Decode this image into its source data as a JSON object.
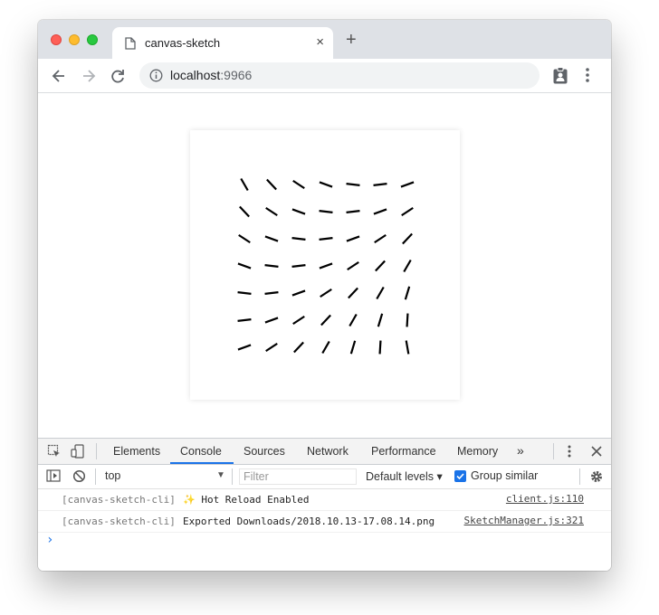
{
  "browser": {
    "tab_title": "canvas-sketch",
    "close_tab_glyph": "×",
    "new_tab_glyph": "+",
    "url_host": "localhost",
    "url_port": ":9966"
  },
  "sketch": {
    "grid_rows": 7,
    "grid_cols": 7,
    "line_color": "#000000",
    "background": "#ffffff"
  },
  "devtools": {
    "tabs": [
      "Elements",
      "Console",
      "Sources",
      "Network",
      "Performance",
      "Memory"
    ],
    "active_tab": "Console",
    "overflow_glyph": "»",
    "context": "top",
    "filter_placeholder": "Filter",
    "levels": "Default levels ▾",
    "group_similar": "Group similar",
    "group_similar_checked": true,
    "messages": [
      {
        "prefix": "[canvas-sketch-cli]",
        "text": "✨ Hot Reload Enabled",
        "source": "client.js:110"
      },
      {
        "prefix": "[canvas-sketch-cli]",
        "text": "Exported Downloads/2018.10.13-17.08.14.png",
        "source": "SketchManager.js:321"
      }
    ],
    "prompt_glyph": "›"
  },
  "colors": {
    "accent": "#1a73e8",
    "traffic_red": "#fe5f57",
    "traffic_yellow": "#febc2e",
    "traffic_green": "#28c840"
  },
  "icons": [
    "page-icon",
    "back-arrow-icon",
    "forward-arrow-icon",
    "reload-icon",
    "info-icon",
    "extension-icon",
    "menu-dots-icon",
    "inspect-icon",
    "device-icon",
    "sidebar-icon",
    "clear-console-icon",
    "settings-gear-icon"
  ]
}
